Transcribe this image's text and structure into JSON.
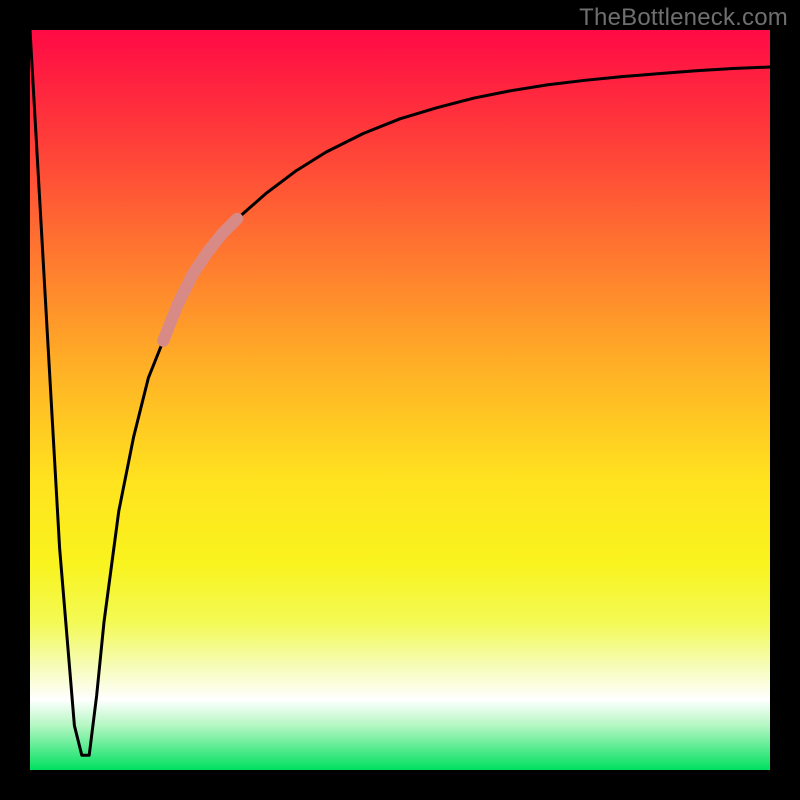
{
  "watermark": "TheBottleneck.com",
  "chart_data": {
    "type": "line",
    "title": "",
    "xlabel": "",
    "ylabel": "",
    "xlim": [
      0,
      100
    ],
    "ylim": [
      0,
      100
    ],
    "grid": false,
    "legend": false,
    "series": [
      {
        "name": "main-curve",
        "color": "#000000",
        "x": [
          0,
          2,
          4,
          6,
          7,
          8,
          9,
          10,
          12,
          14,
          16,
          18,
          20,
          22,
          25,
          28,
          32,
          36,
          40,
          45,
          50,
          55,
          60,
          65,
          70,
          75,
          80,
          85,
          90,
          95,
          100
        ],
        "y": [
          100,
          65,
          30,
          6,
          2,
          2,
          10,
          20,
          35,
          45,
          53,
          58,
          63,
          67,
          71,
          74.5,
          78,
          81,
          83.5,
          86,
          88,
          89.5,
          90.8,
          91.8,
          92.6,
          93.2,
          93.7,
          94.1,
          94.5,
          94.8,
          95
        ]
      },
      {
        "name": "highlight-segment",
        "color": "#d88a87",
        "x": [
          18,
          20,
          22,
          24,
          26,
          28
        ],
        "y": [
          58,
          63,
          67,
          70,
          72.5,
          74.5
        ]
      }
    ],
    "gradient_stops": [
      {
        "pos": 0.0,
        "color": "#ff0a45"
      },
      {
        "pos": 0.14,
        "color": "#ff3a3a"
      },
      {
        "pos": 0.31,
        "color": "#ff7a2f"
      },
      {
        "pos": 0.45,
        "color": "#ffae26"
      },
      {
        "pos": 0.61,
        "color": "#ffe31f"
      },
      {
        "pos": 0.72,
        "color": "#f9f31e"
      },
      {
        "pos": 0.8,
        "color": "#f3fa54"
      },
      {
        "pos": 0.86,
        "color": "#f6fcb8"
      },
      {
        "pos": 0.905,
        "color": "#ffffff"
      },
      {
        "pos": 0.94,
        "color": "#b4f7c2"
      },
      {
        "pos": 1.0,
        "color": "#00e060"
      }
    ]
  }
}
